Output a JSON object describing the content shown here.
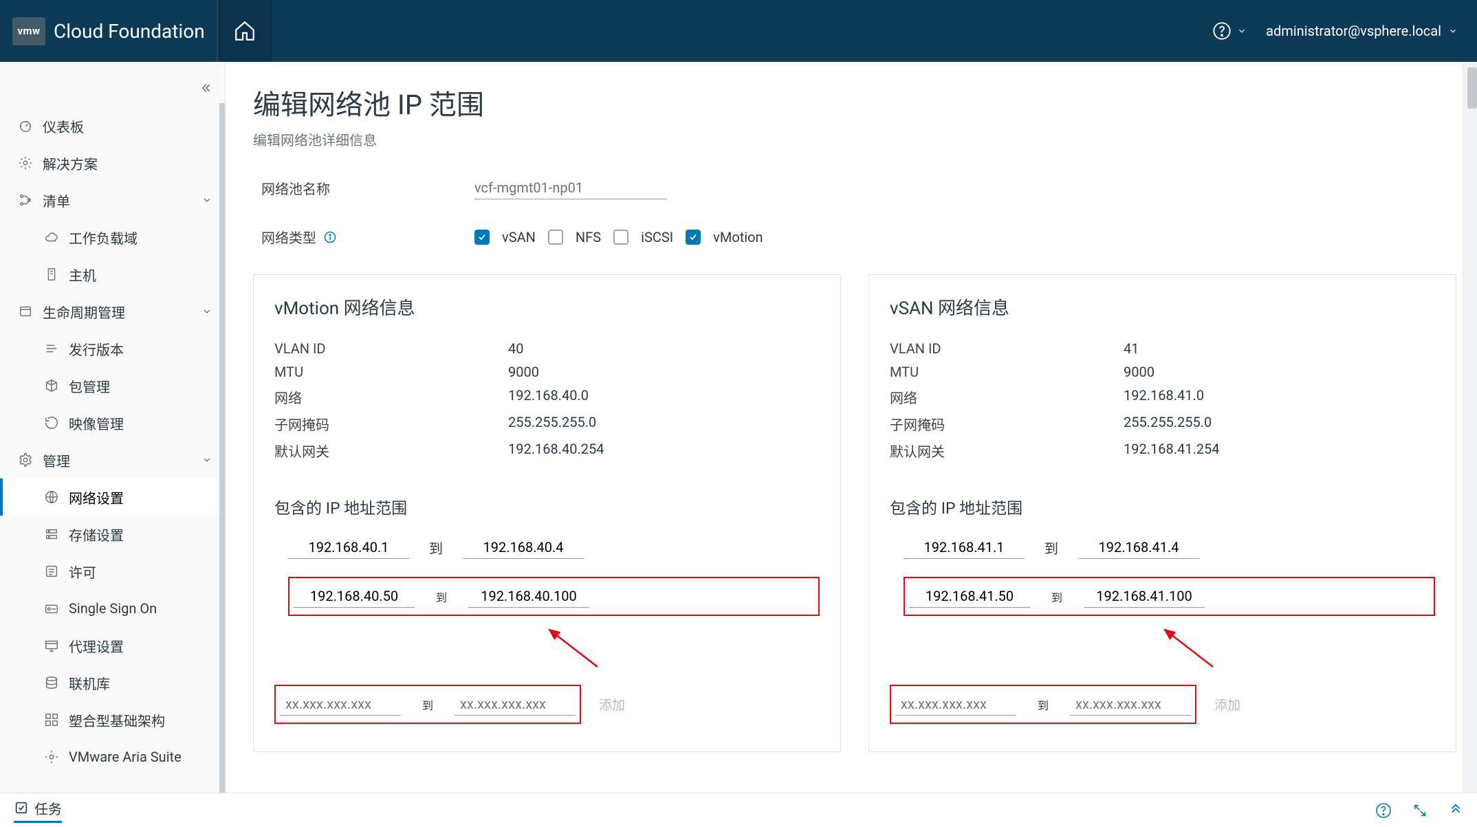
{
  "header": {
    "brand_badge": "vmw",
    "brand_title": "Cloud Foundation",
    "user": "administrator@vsphere.local"
  },
  "sidebar": {
    "items": [
      {
        "label": "仪表板",
        "icon": "dashboard",
        "children": null,
        "expanded": false
      },
      {
        "label": "解决方案",
        "icon": "solutions",
        "children": null,
        "expanded": false
      },
      {
        "label": "清单",
        "icon": "inventory",
        "expanded": true,
        "children": [
          {
            "label": "工作负载域",
            "icon": "cloud"
          },
          {
            "label": "主机",
            "icon": "host"
          }
        ]
      },
      {
        "label": "生命周期管理",
        "icon": "lifecycle",
        "expanded": true,
        "children": [
          {
            "label": "发行版本",
            "icon": "release"
          },
          {
            "label": "包管理",
            "icon": "package"
          },
          {
            "label": "映像管理",
            "icon": "image"
          }
        ]
      },
      {
        "label": "管理",
        "icon": "admin",
        "expanded": true,
        "children": [
          {
            "label": "网络设置",
            "icon": "network",
            "active": true
          },
          {
            "label": "存储设置",
            "icon": "storage"
          },
          {
            "label": "许可",
            "icon": "license"
          },
          {
            "label": "Single Sign On",
            "icon": "sso"
          },
          {
            "label": "代理设置",
            "icon": "proxy"
          },
          {
            "label": "联机库",
            "icon": "onlinerepo"
          },
          {
            "label": "塑合型基础架构",
            "icon": "composable"
          },
          {
            "label": "VMware Aria Suite",
            "icon": "aria"
          }
        ]
      }
    ]
  },
  "page": {
    "title": "编辑网络池 IP 范围",
    "subtitle": "编辑网络池详细信息",
    "pool_name_label": "网络池名称",
    "pool_name_value": "vcf-mgmt01-np01",
    "net_type_label": "网络类型",
    "net_types": [
      {
        "label": "vSAN",
        "checked": true
      },
      {
        "label": "NFS",
        "checked": false
      },
      {
        "label": "iSCSI",
        "checked": false
      },
      {
        "label": "vMotion",
        "checked": true
      }
    ],
    "add_link_label": "添加",
    "to_label": "到",
    "ip_placeholder": "xx.xxx.xxx.xxx",
    "cards": [
      {
        "title": "vMotion 网络信息",
        "info": [
          {
            "k": "VLAN ID",
            "v": "40"
          },
          {
            "k": "MTU",
            "v": "9000"
          },
          {
            "k": "网络",
            "v": "192.168.40.0"
          },
          {
            "k": "子网掩码",
            "v": "255.255.255.0"
          },
          {
            "k": "默认网关",
            "v": "192.168.40.254"
          }
        ],
        "ip_heading": "包含的 IP 地址范围",
        "ranges": [
          {
            "from": "192.168.40.1",
            "to": "192.168.40.4",
            "highlight": false
          },
          {
            "from": "192.168.40.50",
            "to": "192.168.40.100",
            "highlight": true
          }
        ]
      },
      {
        "title": "vSAN 网络信息",
        "info": [
          {
            "k": "VLAN ID",
            "v": "41"
          },
          {
            "k": "MTU",
            "v": "9000"
          },
          {
            "k": "网络",
            "v": "192.168.41.0"
          },
          {
            "k": "子网掩码",
            "v": "255.255.255.0"
          },
          {
            "k": "默认网关",
            "v": "192.168.41.254"
          }
        ],
        "ip_heading": "包含的 IP 地址范围",
        "ranges": [
          {
            "from": "192.168.41.1",
            "to": "192.168.41.4",
            "highlight": false
          },
          {
            "from": "192.168.41.50",
            "to": "192.168.41.100",
            "highlight": true
          }
        ]
      }
    ]
  },
  "footer": {
    "tasks": "任务"
  }
}
